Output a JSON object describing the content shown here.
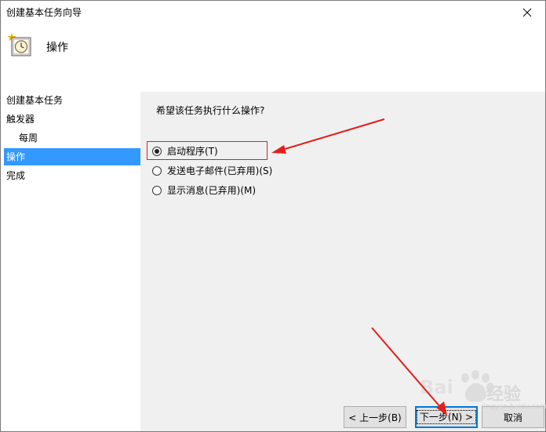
{
  "window": {
    "title": "创建基本任务向导"
  },
  "header": {
    "title": "操作"
  },
  "sidebar": {
    "items": [
      {
        "label": "创建基本任务",
        "selected": false
      },
      {
        "label": "触发器",
        "selected": false
      },
      {
        "label": "每周",
        "selected": false,
        "sub": true
      },
      {
        "label": "操作",
        "selected": true
      },
      {
        "label": "完成",
        "selected": false
      }
    ]
  },
  "main": {
    "question": "希望该任务执行什么操作?",
    "options": [
      {
        "label": "启动程序(T)",
        "checked": true
      },
      {
        "label": "发送电子邮件(已弃用)(S)",
        "checked": false
      },
      {
        "label": "显示消息(已弃用)(M)",
        "checked": false
      }
    ]
  },
  "buttons": {
    "back": "< 上一步(B)",
    "next": "下一步(N) >",
    "cancel": "取消"
  },
  "watermark": {
    "brand": "经验",
    "url": "jingyan.baidu.com"
  },
  "colors": {
    "selection": "#3399ff",
    "annotation": "#e0201b",
    "default_button_border": "#0078d7"
  },
  "icons": [
    "close-icon",
    "task-clock-icon",
    "radio-icon"
  ]
}
